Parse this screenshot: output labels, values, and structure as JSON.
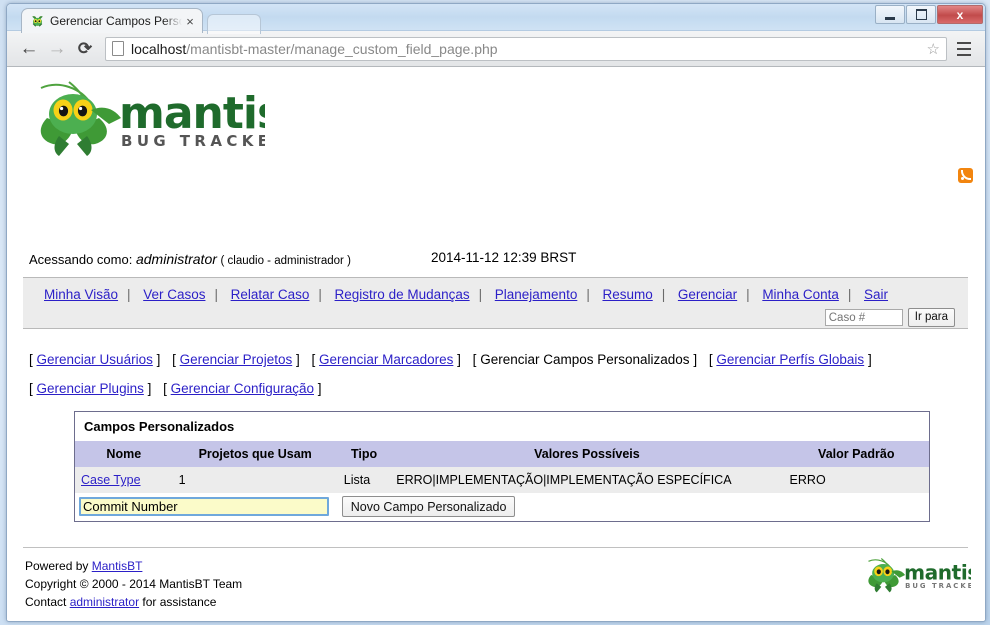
{
  "window": {
    "minimize_label": "Minimize",
    "maximize_label": "Maximize",
    "close_label": "x"
  },
  "tab": {
    "title": "Gerenciar Campos Person",
    "close_label": "×",
    "favicon": "mantis-favicon-icon"
  },
  "browser": {
    "back_label": "←",
    "forward_label": "→",
    "reload_label": "⟳",
    "url_host": "localhost",
    "url_path": "/mantisbt-master/manage_custom_field_page.php",
    "star_label": "☆",
    "menu_label": "menu"
  },
  "header": {
    "logo_alt": "mantis",
    "logo_sub": "BUG TRACKER",
    "access_label": "Acessando como:",
    "username": "administrator",
    "realname": "( claudio - administrador )",
    "datetime": "2014-11-12 12:39 BRST",
    "rss_label": "rss-feed"
  },
  "menu": {
    "items": [
      {
        "label": "Minha Visão"
      },
      {
        "label": "Ver Casos"
      },
      {
        "label": "Relatar Caso"
      },
      {
        "label": "Registro de Mudanças"
      },
      {
        "label": "Planejamento"
      },
      {
        "label": "Resumo"
      },
      {
        "label": "Gerenciar"
      },
      {
        "label": "Minha Conta"
      },
      {
        "label": "Sair"
      }
    ],
    "separator": "|",
    "goto_placeholder": "Caso #",
    "goto_value": "",
    "goto_button": "Ir para"
  },
  "manage_links": {
    "row1": [
      {
        "label": "Gerenciar Usuários",
        "link": true
      },
      {
        "label": "Gerenciar Projetos",
        "link": true
      },
      {
        "label": "Gerenciar Marcadores",
        "link": true
      },
      {
        "label": "Gerenciar Campos Personalizados",
        "link": false
      },
      {
        "label": "Gerenciar Perfís Globais",
        "link": true
      }
    ],
    "row2": [
      {
        "label": "Gerenciar Plugins",
        "link": true
      },
      {
        "label": "Gerenciar Configuração",
        "link": true
      }
    ],
    "bracket_open": "[",
    "bracket_close": "]"
  },
  "table": {
    "caption": "Campos Personalizados",
    "columns": [
      "Nome",
      "Projetos que Usam",
      "Tipo",
      "Valores Possíveis",
      "Valor Padrão"
    ],
    "rows": [
      {
        "nome": "Case Type",
        "projetos": "1",
        "tipo": "Lista",
        "valores": "ERRO|IMPLEMENTAÇÃO|IMPLEMENTAÇÃO ESPECÍFICA",
        "padrao": "ERRO"
      }
    ],
    "new_field_value": "Commit Number",
    "new_field_placeholder": "",
    "new_field_button": "Novo Campo Personalizado"
  },
  "footer": {
    "powered_prefix": "Powered by",
    "powered_link": "MantisBT",
    "copyright": "Copyright © 2000 - 2014 MantisBT Team",
    "contact_prefix": "Contact",
    "contact_link": "administrator",
    "contact_suffix": "for assistance",
    "logo_alt": "mantis bug tracker"
  },
  "colors": {
    "link": "#2b1fc7",
    "table_header": "#c5c5e8",
    "table_row": "#ececec",
    "input_focus_border": "#6fa8dc",
    "input_autofill_bg": "#fbfbc9",
    "mantis_green": "#2f7d32",
    "rss_orange": "#f2850f"
  }
}
